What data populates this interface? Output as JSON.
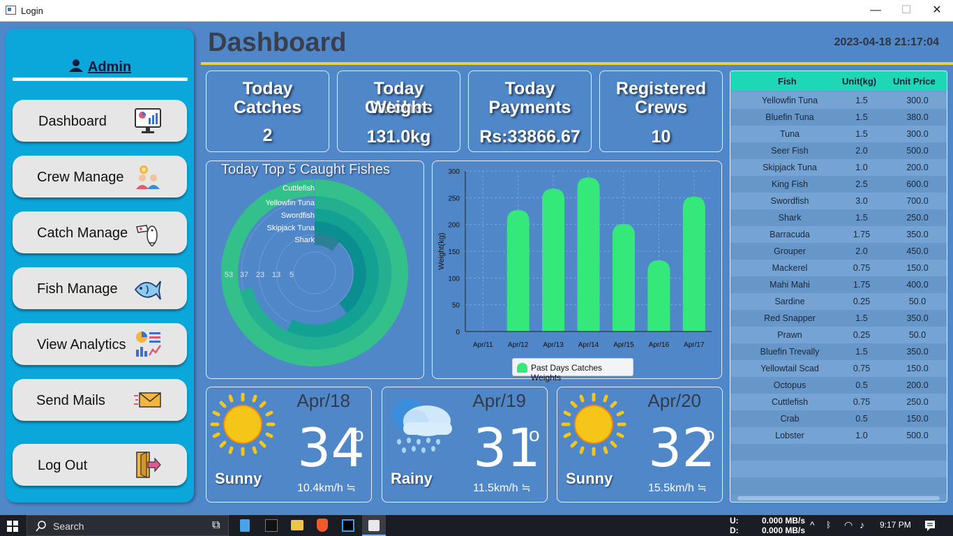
{
  "window": {
    "title": "Login",
    "minimize": "—",
    "maximize": "☐",
    "close": "✕"
  },
  "sidebar": {
    "user_icon": "user-icon",
    "admin_label": "Admin",
    "items": [
      {
        "label": "Dashboard",
        "icon": "dashboard-monitor-icon"
      },
      {
        "label": "Crew Manage",
        "icon": "crew-icon"
      },
      {
        "label": "Catch Manage",
        "icon": "catch-fish-icon"
      },
      {
        "label": "Fish Manage",
        "icon": "fish-icon"
      },
      {
        "label": "View Analytics",
        "icon": "analytics-icon"
      },
      {
        "label": "Send Mails",
        "icon": "mail-icon"
      },
      {
        "label": "Log Out",
        "icon": "logout-door-icon"
      }
    ]
  },
  "header": {
    "title": "Dashboard",
    "datetime": "2023-04-18 21:17:04"
  },
  "stats": [
    {
      "title_lines": [
        "Today",
        "Catches"
      ],
      "value": "2"
    },
    {
      "title_lines": [
        "Today Catches",
        "Weight"
      ],
      "value": "131.0kg"
    },
    {
      "title_lines": [
        "Today",
        "Payments"
      ],
      "value": "Rs:33866.67"
    },
    {
      "title_lines": [
        "Registered",
        "Crews"
      ],
      "value": "10"
    }
  ],
  "chart_data": [
    {
      "type": "radial-bar",
      "title": "Today Top 5 Caught Fishes",
      "categories": [
        "Cuttlefish",
        "Yellowfin Tuna",
        "Swordfish",
        "Skipjack Tuna",
        "Shark"
      ],
      "values": [
        56,
        40,
        32,
        22,
        6
      ],
      "axis_ticks": [
        "53",
        "37",
        "23",
        "13",
        "5"
      ],
      "colors": [
        "#33c08a",
        "#23b090",
        "#13a193",
        "#0b8e8f",
        "#2d7f96"
      ]
    },
    {
      "type": "bar",
      "title": "",
      "categories": [
        "Apr/11",
        "Apr/12",
        "Apr/13",
        "Apr/14",
        "Apr/15",
        "Apr/16",
        "Apr/17"
      ],
      "series": [
        {
          "name": "Past Days Catches Weights",
          "values": [
            0,
            227,
            267,
            288,
            201,
            133,
            252
          ]
        }
      ],
      "ylabel": "Weight(kg)",
      "ylim": [
        0,
        300
      ],
      "yticks": [
        "0",
        "50",
        "100",
        "150",
        "200",
        "250",
        "300"
      ],
      "grid": true,
      "legend": "bottom",
      "color": "#35e87a"
    }
  ],
  "weather": [
    {
      "date": "Apr/18",
      "temp": "34",
      "deg": "o",
      "condition": "Sunny",
      "wind": "10.4km/h",
      "icon": "sun-icon"
    },
    {
      "date": "Apr/19",
      "temp": "31",
      "deg": "o",
      "condition": "Rainy",
      "wind": "11.5km/h",
      "icon": "rain-cloud-icon"
    },
    {
      "date": "Apr/20",
      "temp": "32",
      "deg": "o",
      "condition": "Sunny",
      "wind": "15.5km/h",
      "icon": "sun-icon"
    }
  ],
  "fish_table": {
    "columns": [
      "Fish",
      "Unit(kg)",
      "Unit Price"
    ],
    "rows": [
      [
        "Yellowfin Tuna",
        "1.5",
        "300.0"
      ],
      [
        "Bluefin Tuna",
        "1.5",
        "380.0"
      ],
      [
        "Tuna",
        "1.5",
        "300.0"
      ],
      [
        "Seer Fish",
        "2.0",
        "500.0"
      ],
      [
        "Skipjack Tuna",
        "1.0",
        "200.0"
      ],
      [
        "King Fish",
        "2.5",
        "600.0"
      ],
      [
        "Swordfish",
        "3.0",
        "700.0"
      ],
      [
        "Shark",
        "1.5",
        "250.0"
      ],
      [
        "Barracuda",
        "1.75",
        "350.0"
      ],
      [
        "Grouper",
        "2.0",
        "450.0"
      ],
      [
        "Mackerel",
        "0.75",
        "150.0"
      ],
      [
        "Mahi Mahi",
        "1.75",
        "400.0"
      ],
      [
        "Sardine",
        "0.25",
        "50.0"
      ],
      [
        "Red Snapper",
        "1.5",
        "350.0"
      ],
      [
        "Prawn",
        "0.25",
        "50.0"
      ],
      [
        "Bluefin Trevally",
        "1.5",
        "350.0"
      ],
      [
        "Yellowtail Scad",
        "0.75",
        "150.0"
      ],
      [
        "Octopus",
        "0.5",
        "200.0"
      ],
      [
        "Cuttlefish",
        "0.75",
        "250.0"
      ],
      [
        "Crab",
        "0.5",
        "150.0"
      ],
      [
        "Lobster",
        "1.0",
        "500.0"
      ]
    ]
  },
  "taskbar": {
    "search": "Search",
    "net_up_label": "U:",
    "net_down_label": "D:",
    "net_up": "0.000 MB/s",
    "net_down": "0.000 MB/s",
    "time": "9:17 PM"
  },
  "colors": {
    "accent": "#f0d03a",
    "sidebar": "#0ba6da",
    "background": "#4f87c8",
    "bar": "#35e87a",
    "table_header": "#1dd7b7"
  }
}
